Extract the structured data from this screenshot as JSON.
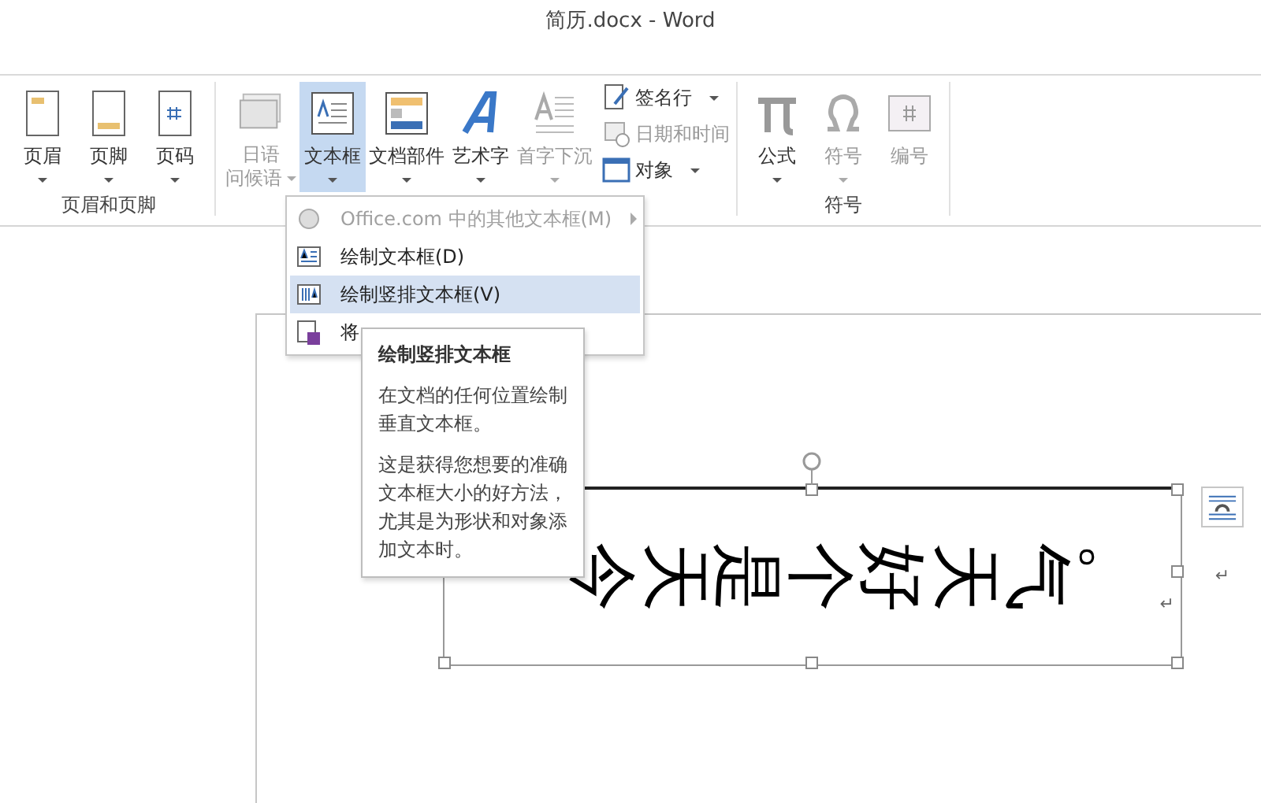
{
  "window": {
    "title": "简历.docx - Word"
  },
  "ribbon": {
    "groups": [
      {
        "label": "页眉和页脚",
        "items": [
          {
            "kind": "large",
            "lines": [
              "页眉"
            ],
            "dropdown": true,
            "disabled": false,
            "selected": false
          },
          {
            "kind": "large",
            "lines": [
              "页脚"
            ],
            "dropdown": true,
            "disabled": false,
            "selected": false
          },
          {
            "kind": "large",
            "lines": [
              "页码"
            ],
            "dropdown": true,
            "disabled": false,
            "selected": false
          }
        ]
      },
      {
        "items": [
          {
            "kind": "large",
            "lines": [
              "日语",
              "问候语"
            ],
            "dropdown": true,
            "disabled": true,
            "selected": false
          },
          {
            "kind": "large",
            "lines": [
              "文本框"
            ],
            "dropdown": true,
            "disabled": false,
            "selected": true
          },
          {
            "kind": "large",
            "lines": [
              "文档部件"
            ],
            "dropdown": true,
            "disabled": false,
            "selected": false
          },
          {
            "kind": "large",
            "lines": [
              "艺术字"
            ],
            "dropdown": true,
            "disabled": false,
            "selected": false
          },
          {
            "kind": "large",
            "lines": [
              "首字下沉"
            ],
            "dropdown": true,
            "disabled": true,
            "selected": false
          },
          {
            "kind": "small",
            "lines": [
              "签名行"
            ],
            "dropdown": true,
            "disabled": false
          },
          {
            "kind": "small",
            "lines": [
              "日期和时间"
            ],
            "dropdown": false,
            "disabled": true
          },
          {
            "kind": "small",
            "lines": [
              "对象"
            ],
            "dropdown": true,
            "disabled": false
          }
        ]
      },
      {
        "label": "符号",
        "items": [
          {
            "kind": "large",
            "lines": [
              "公式"
            ],
            "dropdown": true,
            "disabled": false,
            "selected": false
          },
          {
            "kind": "large",
            "lines": [
              "符号"
            ],
            "dropdown": true,
            "disabled": true,
            "selected": false
          },
          {
            "kind": "large",
            "lines": [
              "编号"
            ],
            "dropdown": false,
            "disabled": true,
            "selected": false
          }
        ]
      }
    ]
  },
  "menu": {
    "items": [
      {
        "label": "Office.com 中的其他文本框(M)",
        "disabled": true,
        "submenu": true,
        "selected": false
      },
      {
        "label": "绘制文本框(D)",
        "disabled": false,
        "submenu": false,
        "selected": false
      },
      {
        "label": "绘制竖排文本框(V)",
        "disabled": false,
        "submenu": false,
        "selected": true
      },
      {
        "label": "将",
        "disabled": false,
        "submenu": false,
        "selected": false
      }
    ]
  },
  "tooltip": {
    "title": "绘制竖排文本框",
    "paragraphs": [
      "在文档的任何位置绘制垂直文本框。",
      "这是获得您想要的准确文本框大小的好方法，尤其是为形状和对象添加文本时。"
    ]
  },
  "document": {
    "text_box": {
      "text": "今天是个好天气。",
      "paragraph_mark": "↵"
    },
    "paragraph_mark": "↵"
  }
}
